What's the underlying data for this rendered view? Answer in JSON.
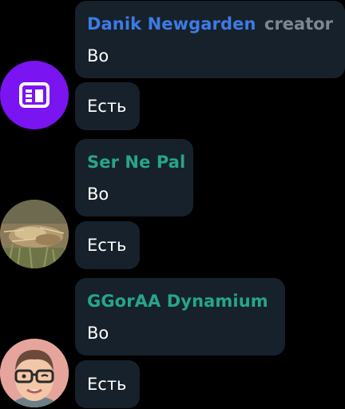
{
  "messages": [
    {
      "author": "Danik Newgarden",
      "role": "creator",
      "avatar_icon": "newspaper-icon",
      "avatar_color": "#7a14f0",
      "name_color": "#3d7be4",
      "text": "Во",
      "followup": "Есть"
    },
    {
      "author": "Ser Ne Pal",
      "avatar_icon": "grass-photo",
      "name_color": "#26a58c",
      "text": "Во",
      "followup": "Есть"
    },
    {
      "author": "GGorAA Dynamium",
      "avatar_icon": "memoji-with-glasses",
      "avatar_color": "#e6a59c",
      "name_color": "#26a58c",
      "text": "Во",
      "followup": "Есть"
    }
  ]
}
